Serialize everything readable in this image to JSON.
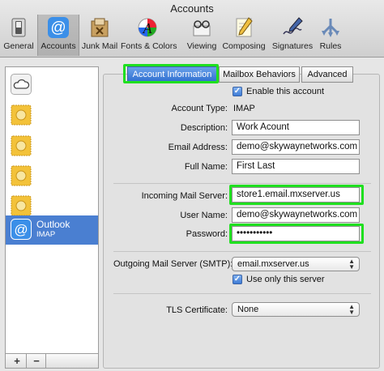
{
  "window": {
    "title": "Accounts"
  },
  "toolbar": {
    "items": [
      {
        "label": "General",
        "icon": "switch-icon"
      },
      {
        "label": "Accounts",
        "icon": "at-sign-icon",
        "selected": true
      },
      {
        "label": "Junk Mail",
        "icon": "junk-mail-icon"
      },
      {
        "label": "Fonts & Colors",
        "icon": "fonts-colors-icon"
      },
      {
        "label": "Viewing",
        "icon": "glasses-icon"
      },
      {
        "label": "Composing",
        "icon": "pencil-paper-icon"
      },
      {
        "label": "Signatures",
        "icon": "signature-pen-icon"
      },
      {
        "label": "Rules",
        "icon": "rules-icon"
      }
    ]
  },
  "sidebar": {
    "accounts": [
      {
        "icon": "cloud-icon"
      },
      {
        "icon": "stamp-icon"
      },
      {
        "icon": "stamp-icon"
      },
      {
        "icon": "stamp-icon"
      },
      {
        "icon": "stamp-icon"
      },
      {
        "name": "Outlook",
        "sub": "IMAP",
        "icon": "at-sign-icon",
        "selected": true
      }
    ],
    "add_label": "+",
    "remove_label": "−"
  },
  "tabs": [
    {
      "label": "Account Information",
      "active": true
    },
    {
      "label": "Mailbox Behaviors"
    },
    {
      "label": "Advanced"
    }
  ],
  "form": {
    "enable_label": "Enable this account",
    "account_type_label": "Account Type:",
    "account_type_value": "IMAP",
    "description_label": "Description:",
    "description_value": "Work Acount",
    "email_label": "Email Address:",
    "email_value": "demo@skywaynetworks.com",
    "fullname_label": "Full Name:",
    "fullname_value": "First Last",
    "incoming_label": "Incoming Mail Server:",
    "incoming_value": "store1.email.mxserver.us",
    "username_label": "User Name:",
    "username_value": "demo@skywaynetworks.com",
    "password_label": "Password:",
    "password_value": "•••••••••••",
    "outgoing_label": "Outgoing Mail Server (SMTP):",
    "outgoing_value": "email.mxserver.us",
    "only_server_label": "Use only this server",
    "tls_label": "TLS Certificate:",
    "tls_value": "None"
  },
  "colors": {
    "highlight": "#1fe01f",
    "selection": "#4a7fd1"
  }
}
